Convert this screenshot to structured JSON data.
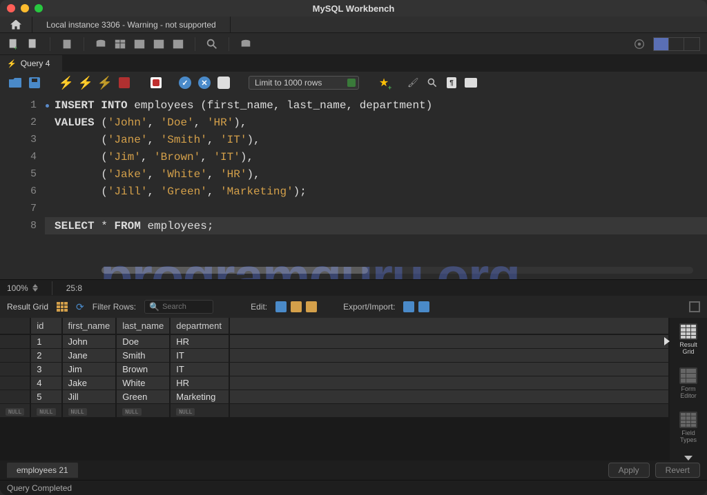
{
  "titlebar": {
    "title": "MySQL Workbench"
  },
  "header": {
    "connection_tab": "Local instance 3306 - Warning - not supported"
  },
  "query_tab": {
    "label": "Query 4"
  },
  "editor_toolbar": {
    "limit": "Limit to 1000 rows"
  },
  "code": {
    "lines": [
      {
        "n": "1",
        "dot": true
      },
      {
        "n": "2",
        "dot": false
      },
      {
        "n": "3",
        "dot": false
      },
      {
        "n": "4",
        "dot": false
      },
      {
        "n": "5",
        "dot": false
      },
      {
        "n": "6",
        "dot": false
      },
      {
        "n": "7",
        "dot": false
      },
      {
        "n": "8",
        "dot": true
      }
    ],
    "l1": {
      "kw1": "INSERT",
      "kw2": "INTO",
      "ident": "employees",
      "cols": "(first_name, last_name, department)"
    },
    "l2": {
      "kw": "VALUES",
      "p": "(",
      "s1": "'John'",
      "c": ",",
      "s2": "'Doe'",
      "s3": "'HR'",
      "tail": "),"
    },
    "l3": {
      "p": "       (",
      "s1": "'Jane'",
      "c": ",",
      "s2": "'Smith'",
      "s3": "'IT'",
      "tail": "),"
    },
    "l4": {
      "p": "       (",
      "s1": "'Jim'",
      "c": ",",
      "s2": "'Brown'",
      "s3": "'IT'",
      "tail": "),"
    },
    "l5": {
      "p": "       (",
      "s1": "'Jake'",
      "c": ",",
      "s2": "'White'",
      "s3": "'HR'",
      "tail": "),"
    },
    "l6": {
      "p": "       (",
      "s1": "'Jill'",
      "c": ",",
      "s2": "'Green'",
      "s3": "'Marketing'",
      "tail": ");"
    },
    "l8": {
      "kw1": "SELECT",
      "star": "*",
      "kw2": "FROM",
      "ident": "employees",
      "semi": ";"
    }
  },
  "watermark": "programguru.org",
  "status_row": {
    "zoom": "100%",
    "cursor": "25:8"
  },
  "results_toolbar": {
    "label": "Result Grid",
    "filter_label": "Filter Rows:",
    "search_placeholder": "Search",
    "edit_label": "Edit:",
    "export_label": "Export/Import:"
  },
  "results": {
    "columns": [
      "id",
      "first_name",
      "last_name",
      "department"
    ],
    "rows": [
      {
        "id": "1",
        "first_name": "John",
        "last_name": "Doe",
        "department": "HR"
      },
      {
        "id": "2",
        "first_name": "Jane",
        "last_name": "Smith",
        "department": "IT"
      },
      {
        "id": "3",
        "first_name": "Jim",
        "last_name": "Brown",
        "department": "IT"
      },
      {
        "id": "4",
        "first_name": "Jake",
        "last_name": "White",
        "department": "HR"
      },
      {
        "id": "5",
        "first_name": "Jill",
        "last_name": "Green",
        "department": "Marketing"
      }
    ],
    "null_label": "NULL"
  },
  "results_sidebar": {
    "result_grid": "Result\nGrid",
    "form_editor": "Form\nEditor",
    "field_types": "Field\nTypes"
  },
  "bottom": {
    "tab": "employees 21",
    "apply": "Apply",
    "revert": "Revert"
  },
  "status_bar": {
    "text": "Query Completed"
  }
}
